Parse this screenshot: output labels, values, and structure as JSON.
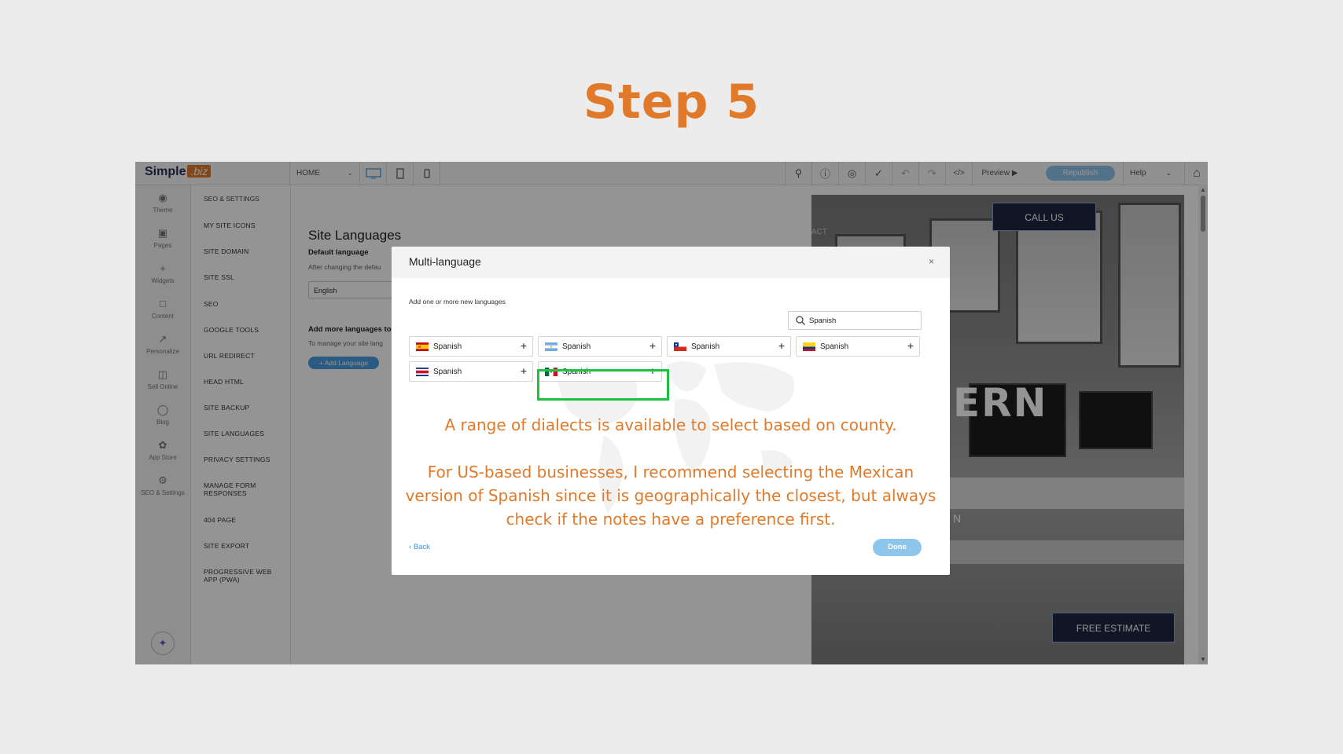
{
  "page": {
    "title": "Step 5"
  },
  "toolbar": {
    "logo_text": "Simple",
    "logo_badge": ".biz",
    "page_select": "HOME",
    "preview_label": "Preview ▶",
    "republish_label": "Republish",
    "help_label": "Help",
    "icons": [
      "search-icon",
      "info-icon",
      "comment-icon",
      "check-icon",
      "undo-icon",
      "redo-icon",
      "code-icon",
      "home-icon"
    ]
  },
  "rail": {
    "items": [
      {
        "label": "Theme",
        "icon": "palette-icon"
      },
      {
        "label": "Pages",
        "icon": "pages-icon"
      },
      {
        "label": "Widgets",
        "icon": "plus-icon"
      },
      {
        "label": "Content",
        "icon": "folder-icon"
      },
      {
        "label": "Personalize",
        "icon": "personalize-icon"
      },
      {
        "label": "Sell Online",
        "icon": "cart-icon"
      },
      {
        "label": "Blog",
        "icon": "chat-icon"
      },
      {
        "label": "App Store",
        "icon": "puzzle-icon"
      },
      {
        "label": "SEO & Settings",
        "icon": "gear-icon"
      }
    ]
  },
  "settings": {
    "heading": "SEO & SETTINGS",
    "items": [
      "MY SITE ICONS",
      "SITE DOMAIN",
      "SITE SSL",
      "SEO",
      "GOOGLE TOOLS",
      "URL REDIRECT",
      "HEAD HTML",
      "SITE BACKUP",
      "SITE LANGUAGES",
      "PRIVACY SETTINGS",
      "MANAGE FORM RESPONSES",
      "404 PAGE",
      "SITE EXPORT",
      "PROGRESSIVE WEB APP (PWA)"
    ]
  },
  "main": {
    "title": "Site Languages",
    "default_language_label": "Default language",
    "after_changing_text": "After changing the defau",
    "default_language_value": "English",
    "add_more_label": "Add more languages to",
    "manage_text": "To manage your site lang",
    "add_language_btn": "+ Add Language"
  },
  "preview_site": {
    "call_us": "CALL US",
    "free_estimate": "FREE ESTIMATE",
    "hero_text": "ERN",
    "hero_small": "N",
    "nav_fragment": "ACT"
  },
  "modal": {
    "title": "Multi-language",
    "subtitle": "Add one or more new languages",
    "search_value": "Spanish",
    "languages": [
      {
        "name": "Spanish",
        "flag": "spain"
      },
      {
        "name": "Spanish",
        "flag": "argentina"
      },
      {
        "name": "Spanish",
        "flag": "chile"
      },
      {
        "name": "Spanish",
        "flag": "colombia"
      },
      {
        "name": "Spanish",
        "flag": "costa-rica"
      },
      {
        "name": "Spanish",
        "flag": "mexico"
      }
    ],
    "back_label": "Back",
    "done_label": "Done"
  },
  "annotation": {
    "line1": "A range of  dialects is available to select based on county.",
    "line2": "For US-based businesses, I recommend selecting the Mexican",
    "line3": "version of Spanish since it is geographically the closest, but always",
    "line4": "check if the notes have a preference first."
  },
  "colors": {
    "accent": "#e07a2a",
    "highlight": "#20c040",
    "link": "#3a8fd6"
  }
}
